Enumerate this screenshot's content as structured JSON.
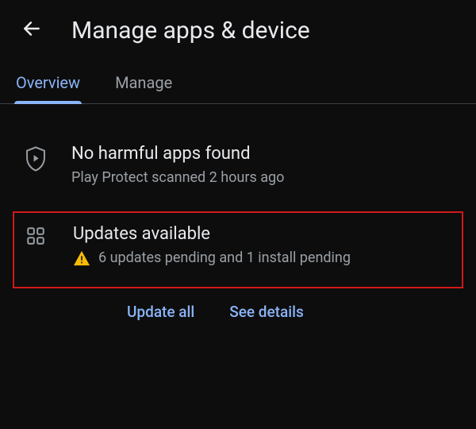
{
  "header": {
    "title": "Manage apps & device"
  },
  "tabs": {
    "overview": "Overview",
    "manage": "Manage"
  },
  "protect": {
    "title": "No harmful apps found",
    "subtitle": "Play Protect scanned 2 hours ago"
  },
  "updates": {
    "title": "Updates available",
    "subtitle": "6 updates pending and 1 install pending",
    "update_all": "Update all",
    "see_details": "See details"
  }
}
